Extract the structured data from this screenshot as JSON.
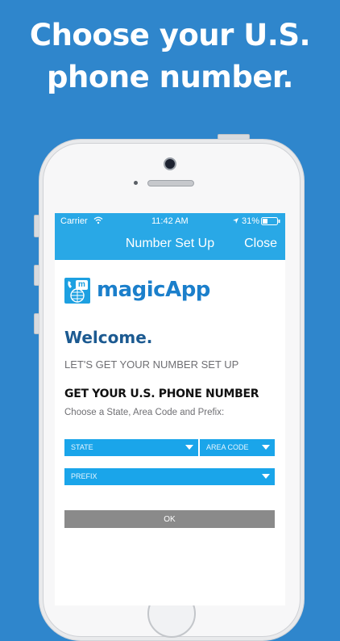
{
  "promo": {
    "line1": "Choose your U.S.",
    "line2": "phone number."
  },
  "status_bar": {
    "carrier": "Carrier",
    "time": "11:42 AM",
    "battery": "31%"
  },
  "nav": {
    "title": "Number Set Up",
    "close_label": "Close"
  },
  "brand": {
    "name": "magicApp",
    "logo_letter": "m"
  },
  "content": {
    "welcome": "Welcome.",
    "subhead": "LET'S GET YOUR NUMBER SET UP",
    "section_title": "GET YOUR U.S. PHONE NUMBER",
    "instructions": "Choose a State, Area Code and Prefix:"
  },
  "form": {
    "state_placeholder": "STATE",
    "area_code_placeholder": "AREA CODE",
    "prefix_placeholder": "PREFIX",
    "ok_label": "OK"
  },
  "colors": {
    "background": "#2f86cc",
    "accent": "#29a8e6",
    "brand_dark": "#1c5a91",
    "button_gray": "#8a8a8a"
  }
}
